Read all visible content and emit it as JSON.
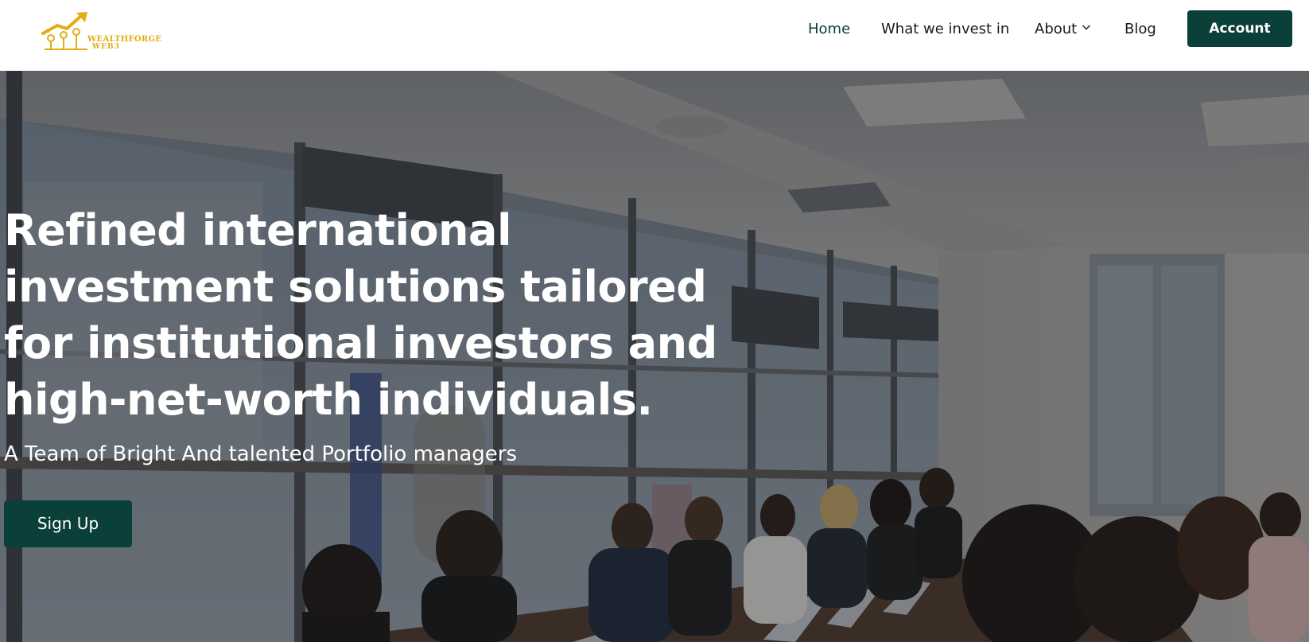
{
  "brand": {
    "name": "WEALTHFORGE",
    "sub": "WEB3",
    "logo_icon": "rising-arrow-keys-logo",
    "accent_color": "#e0ad14"
  },
  "nav": {
    "items": [
      {
        "label": "Home",
        "active": true
      },
      {
        "label": "What we invest in"
      },
      {
        "label": "About",
        "has_dropdown": true,
        "icon": "chevron-down-icon"
      },
      {
        "label": "Blog"
      }
    ],
    "account_label": "Account",
    "active_color": "#0b3d3a"
  },
  "hero": {
    "title": "Refined international investment solutions tailored for institutional investors and high-net-worth individuals.",
    "subtitle": "A Team of Bright And talented Portfolio managers",
    "cta_label": "Sign Up",
    "button_color": "#0a3f3a"
  }
}
